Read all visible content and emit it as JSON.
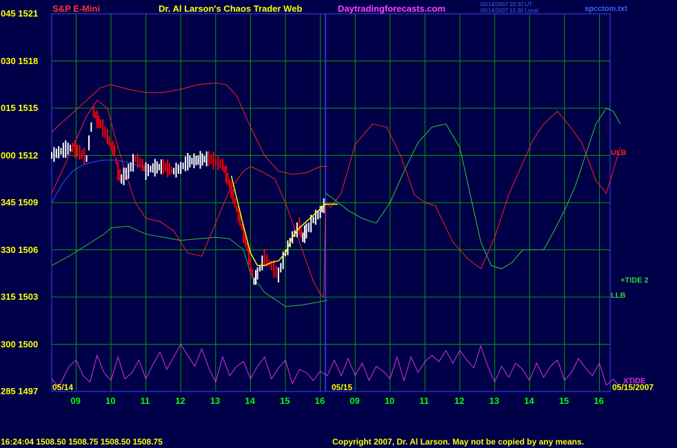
{
  "header": {
    "symbol": "S&P E-Mini",
    "title": "Dr. Al Larson's Chaos Trader Web",
    "site": "Daytradingforecasts.com",
    "time_line1": "05/14/2007 20:30 UT",
    "time_line2": "05/14/2007 15:30 Local",
    "file": "spcctom.txt"
  },
  "y_axis_labels": [
    {
      "left": "045",
      "right": "1521"
    },
    {
      "left": "030",
      "right": "1518"
    },
    {
      "left": "015",
      "right": "1515"
    },
    {
      "left": "000",
      "right": "1512"
    },
    {
      "left": "345",
      "right": "1509"
    },
    {
      "left": "330",
      "right": "1506"
    },
    {
      "left": "315",
      "right": "1503"
    },
    {
      "left": "300",
      "right": "1500"
    },
    {
      "left": "285",
      "right": "1497"
    }
  ],
  "x_labels": [
    "09",
    "10",
    "11",
    "12",
    "13",
    "14",
    "15",
    "16",
    "09",
    "10",
    "11",
    "12",
    "13",
    "14",
    "15",
    "16"
  ],
  "date_labels": {
    "day1": "05/14",
    "day2": "05/15",
    "end": "05/15/2007"
  },
  "line_labels": {
    "ulb": "ULB",
    "llb": "LLB",
    "tide": "+TIDE 2",
    "xtide": "XTIDE"
  },
  "footer": {
    "quote": "16:24:04  1508.50 1508.75 1508.50 1508.75",
    "copyright": "Copyright 2007, Dr. Al Larson. May not be copied by any means."
  },
  "chart_data": {
    "type": "line",
    "title": "S&P E-Mini",
    "ylim": [
      1497,
      1521
    ],
    "y_ticks": [
      1497,
      1500,
      1503,
      1506,
      1509,
      1512,
      1515,
      1518,
      1521
    ],
    "x_range_hours": [
      8.3,
      24.6
    ],
    "colors": {
      "grid": "#00A000",
      "divider": "#4040FF",
      "up": "#FFFFFF",
      "down": "#FF0000",
      "ulb": "#FF2020",
      "llb": "#30C030",
      "tide": "#30D030",
      "xtide": "#E030E0",
      "average": "#FFFF00",
      "blue": "#3050FF",
      "ylabel": "#FFFF00",
      "xlabel": "#00FF00"
    },
    "price": {
      "x": [
        8.3,
        8.5,
        8.7,
        8.9,
        9.1,
        9.3,
        9.5,
        9.6,
        9.7,
        9.9,
        10.0,
        10.1,
        10.2,
        10.3,
        10.5,
        10.7,
        10.9,
        11.0,
        11.2,
        11.5,
        11.8,
        12.0,
        12.2,
        12.5,
        12.8,
        13.0,
        13.2,
        13.3,
        13.4,
        13.5,
        13.6,
        13.7,
        13.8,
        13.9,
        14.0,
        14.1,
        14.2,
        14.4,
        14.6,
        14.8,
        15.0,
        15.2,
        15.4,
        15.5,
        15.6,
        15.8,
        16.0,
        16.15
      ],
      "y": [
        1512.0,
        1512.2,
        1512.4,
        1512.5,
        1512.2,
        1511.8,
        1514.8,
        1514.3,
        1514.0,
        1513.2,
        1512.6,
        1512.3,
        1511.0,
        1510.5,
        1511.0,
        1511.8,
        1511.4,
        1511.0,
        1511.2,
        1511.3,
        1511.0,
        1511.2,
        1511.6,
        1511.7,
        1511.8,
        1511.6,
        1511.4,
        1510.8,
        1510.2,
        1509.4,
        1508.6,
        1507.9,
        1507.0,
        1506.2,
        1505.0,
        1504.0,
        1504.5,
        1505.5,
        1505.0,
        1504.4,
        1505.8,
        1506.8,
        1507.5,
        1506.8,
        1507.2,
        1507.9,
        1508.4,
        1509.0
      ]
    },
    "price_range": 0.35,
    "average": {
      "x": [
        13.45,
        13.6,
        13.8,
        14.0,
        14.2,
        14.4,
        14.6,
        14.8,
        15.0,
        15.2,
        15.4,
        15.6,
        15.8,
        16.0,
        16.15,
        16.5
      ],
      "y": [
        1510.7,
        1509.3,
        1507.5,
        1505.8,
        1505.0,
        1505.0,
        1505.2,
        1505.3,
        1505.8,
        1506.8,
        1507.4,
        1507.8,
        1508.2,
        1508.6,
        1508.9,
        1508.9
      ]
    },
    "ulb": {
      "x": [
        8.3,
        8.8,
        9.3,
        9.7,
        10.0,
        10.5,
        11.0,
        11.5,
        12.0,
        12.5,
        13.0,
        13.3,
        13.6,
        14.0,
        14.4,
        14.8,
        15.2,
        15.6,
        16.0,
        16.2
      ],
      "y": [
        1513.5,
        1514.5,
        1515.5,
        1516.3,
        1516.5,
        1516.2,
        1516.0,
        1516.0,
        1516.2,
        1516.5,
        1516.6,
        1516.5,
        1515.8,
        1513.8,
        1512.0,
        1511.0,
        1510.8,
        1510.9,
        1511.3,
        1511.3
      ]
    },
    "llb": {
      "x": [
        8.3,
        8.8,
        9.3,
        9.8,
        10.0,
        10.5,
        11.0,
        11.5,
        12.0,
        12.5,
        13.0,
        13.4,
        13.8,
        14.0,
        14.4,
        14.8,
        15.0,
        15.5,
        16.0,
        16.2
      ],
      "y": [
        1505.0,
        1505.6,
        1506.3,
        1507.0,
        1507.4,
        1507.5,
        1507.0,
        1506.8,
        1506.6,
        1506.7,
        1506.8,
        1506.7,
        1506.0,
        1504.5,
        1503.3,
        1502.7,
        1502.4,
        1502.5,
        1502.7,
        1502.8
      ]
    },
    "blue_line": {
      "x": [
        8.3,
        8.6,
        8.9,
        9.2,
        9.5,
        9.8,
        10.1,
        10.4,
        10.7,
        11.0
      ],
      "y": [
        1509.0,
        1510.2,
        1511.0,
        1511.4,
        1511.6,
        1511.7,
        1511.7,
        1511.6,
        1511.4,
        1511.2
      ]
    },
    "tide": {
      "x": [
        8.3,
        8.7,
        9.0,
        9.3,
        9.6,
        9.9,
        10.1,
        10.4,
        10.7,
        11.0,
        11.4,
        11.8,
        12.2,
        12.6,
        13.0,
        13.4,
        13.8,
        14.0,
        14.3,
        14.7,
        15.0,
        15.4,
        15.8,
        16.0,
        16.1,
        16.15,
        16.3,
        16.6,
        17.0,
        17.5,
        17.9,
        18.3,
        18.7,
        19.0,
        19.3,
        19.8,
        20.2,
        20.6,
        21.0,
        21.4,
        21.8,
        22.1,
        22.4,
        22.8,
        23.1,
        23.5,
        23.9,
        24.2,
        24.5,
        24.6
      ],
      "y": [
        1509.6,
        1511.5,
        1513.0,
        1514.5,
        1515.5,
        1515.0,
        1513.3,
        1511.0,
        1509.0,
        1508.0,
        1507.8,
        1507.2,
        1505.8,
        1505.6,
        1507.7,
        1509.8,
        1511.0,
        1511.3,
        1511.0,
        1510.5,
        1509.0,
        1506.5,
        1504.0,
        1503.2,
        1503.0,
        1509.0,
        1508.7,
        1509.6,
        1512.7,
        1514.0,
        1513.8,
        1512.0,
        1509.5,
        1509.0,
        1508.8,
        1506.5,
        1505.5,
        1504.8,
        1506.8,
        1509.5,
        1511.5,
        1513.0,
        1514.0,
        1514.8,
        1514.0,
        1512.8,
        1510.4,
        1509.6,
        1511.8,
        1512.5
      ]
    },
    "tide2": {
      "x": [
        16.15,
        16.4,
        16.8,
        17.2,
        17.6,
        18.0,
        18.4,
        18.8,
        19.2,
        19.6,
        20.0,
        20.3,
        20.6,
        20.9,
        21.2,
        21.5,
        21.8,
        22.1,
        22.4,
        22.7,
        23.0,
        23.3,
        23.6,
        23.9,
        24.2,
        24.4,
        24.6
      ],
      "y": [
        1509.6,
        1509.2,
        1508.5,
        1508.0,
        1507.7,
        1509.0,
        1511.0,
        1512.8,
        1513.8,
        1514.0,
        1512.5,
        1509.5,
        1506.5,
        1505.0,
        1504.8,
        1505.2,
        1506.0,
        1506.0,
        1506.0,
        1507.2,
        1508.5,
        1510.0,
        1512.0,
        1514.0,
        1515.0,
        1514.8,
        1514.0
      ]
    },
    "xtide": {
      "x": [
        8.3,
        8.5,
        8.8,
        9.0,
        9.2,
        9.4,
        9.6,
        9.8,
        10.0,
        10.2,
        10.4,
        10.6,
        10.8,
        11.0,
        11.2,
        11.4,
        11.6,
        11.8,
        12.0,
        12.2,
        12.4,
        12.6,
        12.8,
        13.0,
        13.2,
        13.4,
        13.6,
        13.8,
        14.0,
        14.2,
        14.4,
        14.6,
        14.8,
        15.0,
        15.2,
        15.4,
        15.6,
        15.8,
        16.0,
        16.2,
        16.4,
        16.6,
        16.8,
        17.0,
        17.2,
        17.4,
        17.6,
        17.8,
        18.0,
        18.2,
        18.4,
        18.6,
        18.8,
        19.0,
        19.2,
        19.4,
        19.6,
        19.8,
        20.0,
        20.2,
        20.4,
        20.6,
        20.8,
        21.0,
        21.2,
        21.4,
        21.6,
        21.8,
        22.0,
        22.2,
        22.4,
        22.6,
        22.8,
        23.0,
        23.2,
        23.4,
        23.6,
        23.8,
        24.0,
        24.2,
        24.4,
        24.6
      ],
      "y": [
        1497.8,
        1497.3,
        1498.6,
        1499.0,
        1498.0,
        1497.6,
        1499.3,
        1498.2,
        1497.7,
        1499.2,
        1497.8,
        1498.2,
        1499.0,
        1497.8,
        1498.7,
        1499.5,
        1498.4,
        1499.2,
        1500.0,
        1499.3,
        1498.6,
        1499.7,
        1498.5,
        1497.6,
        1499.2,
        1498.0,
        1498.6,
        1498.9,
        1497.8,
        1498.6,
        1499.2,
        1497.8,
        1498.5,
        1499.0,
        1497.5,
        1498.4,
        1498.2,
        1497.7,
        1498.3,
        1498.0,
        1499.0,
        1498.0,
        1499.1,
        1498.0,
        1498.8,
        1497.7,
        1498.6,
        1498.3,
        1497.8,
        1499.2,
        1497.7,
        1499.2,
        1498.2,
        1498.9,
        1499.3,
        1498.9,
        1499.6,
        1498.8,
        1499.6,
        1499.0,
        1498.5,
        1499.9,
        1498.6,
        1497.6,
        1498.6,
        1497.9,
        1498.8,
        1498.4,
        1497.7,
        1498.8,
        1497.9,
        1498.6,
        1499.0,
        1497.7,
        1498.2,
        1499.1,
        1498.5,
        1498.0,
        1498.8,
        1497.4,
        1497.8,
        1497.2
      ]
    }
  }
}
